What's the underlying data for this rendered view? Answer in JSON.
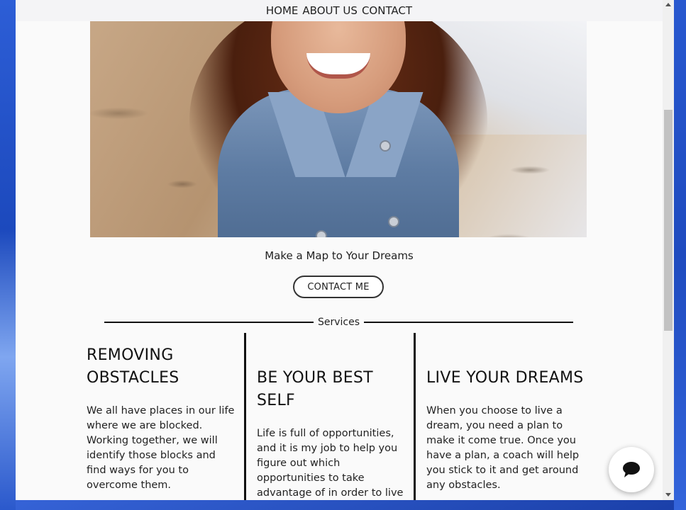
{
  "nav": {
    "items": [
      {
        "label": "HOME"
      },
      {
        "label": "ABOUT US"
      },
      {
        "label": "CONTACT"
      }
    ]
  },
  "hero": {
    "image_icon": "portrait-photo"
  },
  "tagline": "Make a Map to Your Dreams",
  "contact_button": "CONTACT ME",
  "services_heading": "Services",
  "services": [
    {
      "title": "REMOVING OBSTACLES",
      "body": "We all have places in our life where we are blocked. Working together, we will identify those blocks and find ways for you to overcome them."
    },
    {
      "title": "BE YOUR BEST SELF",
      "body": "Life is full of opportunities, and it is my job to help you figure out which opportunities to take advantage of in order to live the life you want."
    },
    {
      "title": "LIVE YOUR DREAMS",
      "body": "When you choose to live a dream, you need a plan to make it come true. Once you have a plan, a coach will help you stick to it and get around any obstacles."
    }
  ],
  "chat": {
    "icon": "chat-bubble-icon"
  },
  "colors": {
    "background": "#fafafa",
    "nav_background": "#f4f4f6",
    "text": "#222222",
    "divider": "#111111"
  }
}
